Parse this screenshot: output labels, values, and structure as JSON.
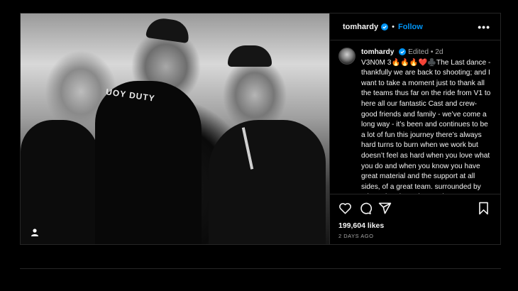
{
  "post": {
    "username": "tomhardy",
    "follow_label": "Follow",
    "separator": "•",
    "more_label": "•••",
    "photo_tee_text": "UOY DUTY",
    "caption": {
      "username": "tomhardy",
      "edited": "Edited",
      "age": "2d",
      "text": "V3N0M 3🔥🔥🔥❤️♣️The Last dance - thankfully we are back to shooting; and I want to take a moment just to thank all the teams thus far on the ride from V1 to here all our fantastic Cast and crew- good friends and family - we’ve come a long way - it’s been and continues to be a lot of fun this journey there’s always hard turns to burn when we work but doesn’t feel as hard when you love what you do and when you know you have great material and the support at all sides, of a great team. surrounded by talented and passionate departments and when surrounded by people you"
    },
    "likes": "199,604 likes",
    "timestamp": "2 DAYS AGO"
  },
  "icons": {
    "verified": "verified-badge-icon",
    "more": "more-options-icon",
    "like": "heart-icon",
    "comment": "comment-icon",
    "share": "share-icon",
    "save": "bookmark-icon",
    "tagged": "user-tag-icon"
  },
  "colors": {
    "background": "#000000",
    "accent": "#0095f6",
    "border": "#262626",
    "muted": "#a8a8a8"
  }
}
